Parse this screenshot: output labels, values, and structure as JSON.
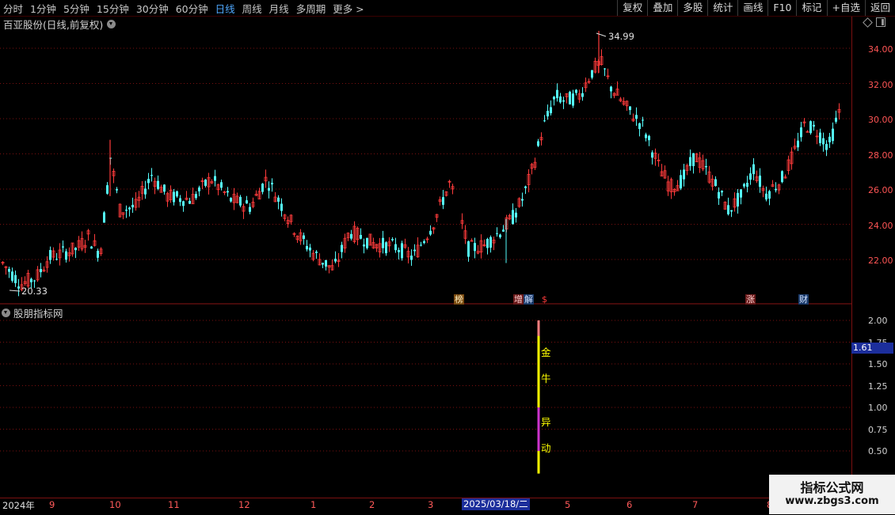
{
  "toolbar": {
    "periods": [
      "分时",
      "1分钟",
      "5分钟",
      "15分钟",
      "30分钟",
      "60分钟",
      "日线",
      "周线",
      "月线",
      "多周期",
      "更多 >"
    ],
    "active_period": "日线",
    "right_buttons": [
      "复权",
      "叠加",
      "多股",
      "统计",
      "画线",
      "F10",
      "标记",
      "+自选",
      "返回"
    ]
  },
  "chart": {
    "title": "百亚股份(日线,前复权)",
    "high_label": "34.99",
    "low_label": "20.33",
    "y_labels": [
      "34.00",
      "32.00",
      "30.00",
      "28.00",
      "26.00",
      "24.00",
      "22.00"
    ],
    "events": [
      "榜",
      "增",
      "解",
      "$",
      "涨",
      "财"
    ]
  },
  "indicator": {
    "title": "股朋指标网",
    "y_labels": [
      "2.00",
      "1.75",
      "1.50",
      "1.25",
      "1.00",
      "0.75",
      "0.50"
    ],
    "cursor_value": "1.61",
    "signal_text": [
      "金",
      "牛",
      "异",
      "动"
    ]
  },
  "x_axis": {
    "labels": [
      "2024年",
      "9",
      "10",
      "11",
      "12",
      "1",
      "2",
      "3",
      "5",
      "6",
      "7",
      "8"
    ],
    "cursor_date": "2025/03/18/二"
  },
  "watermark": {
    "line1": "指标公式网",
    "line2": "www.zbgs3.com"
  },
  "colors": {
    "up": "#ff3b3b",
    "down": "#54fcfc",
    "accent": "#4fa8ff",
    "grid": "#7a1010"
  }
}
